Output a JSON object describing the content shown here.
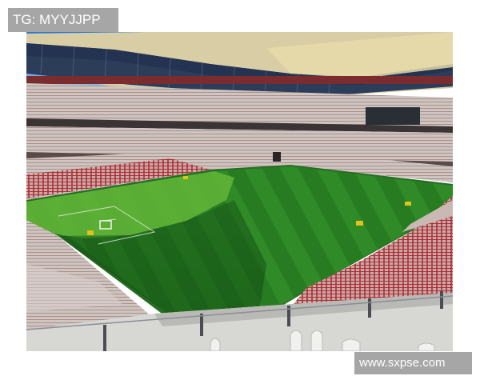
{
  "watermark_top_left": "TG: MYYJJPP",
  "watermark_bottom_right": "www.sxpse.com",
  "colors": {
    "sky": "#3d86d6",
    "roof": "#e8d9a8",
    "pitch_light": "#3f9a2e",
    "pitch_dark": "#1f6b1e",
    "seats": "#c9b9b3",
    "seats_red": "#b8323a"
  }
}
